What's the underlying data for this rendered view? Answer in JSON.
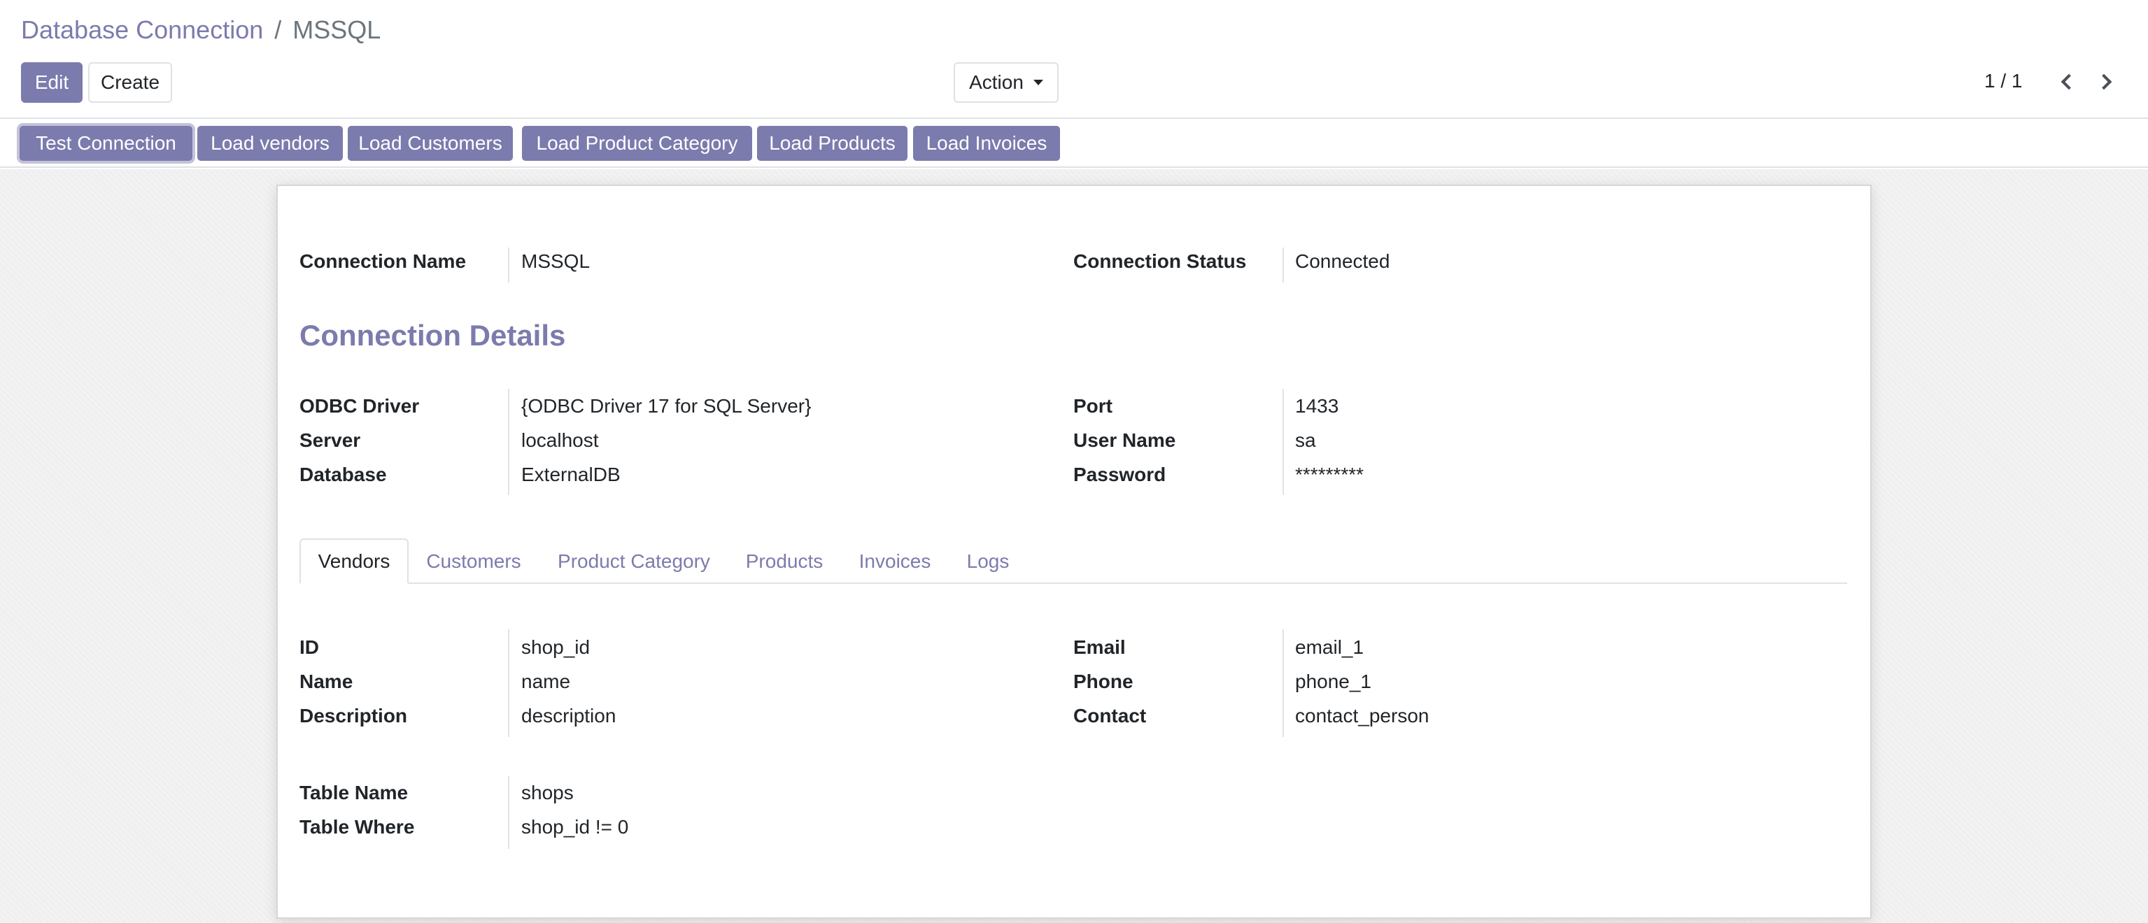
{
  "breadcrumb": {
    "parent": "Database Connection",
    "separator": "/",
    "current": "MSSQL"
  },
  "toolbar": {
    "edit_label": "Edit",
    "create_label": "Create",
    "action_label": "Action"
  },
  "pager": {
    "value": "1 / 1"
  },
  "statusbar": {
    "buttons": [
      "Test Connection",
      "Load vendors",
      "Load Customers",
      "Load Product Category",
      "Load Products",
      "Load Invoices"
    ]
  },
  "form": {
    "connection_name_label": "Connection Name",
    "connection_name": "MSSQL",
    "connection_status_label": "Connection Status",
    "connection_status": "Connected",
    "details_title": "Connection Details",
    "details_left": [
      {
        "label": "ODBC Driver",
        "value": "{ODBC Driver 17 for SQL Server}"
      },
      {
        "label": "Server",
        "value": "localhost"
      },
      {
        "label": "Database",
        "value": "ExternalDB"
      }
    ],
    "details_right": [
      {
        "label": "Port",
        "value": "1433"
      },
      {
        "label": "User Name",
        "value": "sa"
      },
      {
        "label": "Password",
        "value": "*********"
      }
    ]
  },
  "tabs": [
    "Vendors",
    "Customers",
    "Product Category",
    "Products",
    "Invoices",
    "Logs"
  ],
  "vendors": {
    "left": [
      {
        "label": "ID",
        "value": "shop_id"
      },
      {
        "label": "Name",
        "value": "name"
      },
      {
        "label": "Description",
        "value": "description"
      }
    ],
    "right": [
      {
        "label": "Email",
        "value": "email_1"
      },
      {
        "label": "Phone",
        "value": "phone_1"
      },
      {
        "label": "Contact",
        "value": "contact_person"
      }
    ],
    "table": [
      {
        "label": "Table Name",
        "value": "shops"
      },
      {
        "label": "Table Where",
        "value": "shop_id != 0"
      }
    ]
  },
  "colors": {
    "brand": "#7c7bad",
    "text": "#212529",
    "muted": "#6c757d",
    "border": "#dee2e6"
  }
}
